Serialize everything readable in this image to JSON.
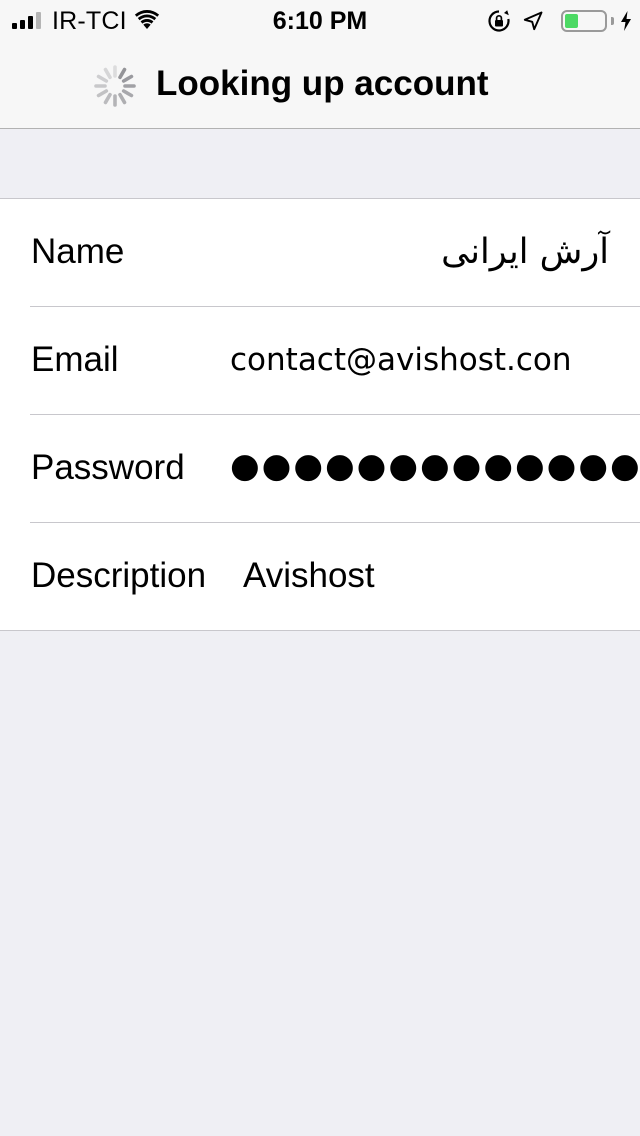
{
  "status_bar": {
    "carrier": "IR-TCI",
    "time": "6:10 PM",
    "battery_level": 0.35,
    "icons": [
      "signal-icon",
      "wifi-icon",
      "rotation-lock-icon",
      "location-icon",
      "battery-icon",
      "charging-icon"
    ]
  },
  "nav": {
    "title": "Looking up account",
    "activity_icon": "spinner-icon"
  },
  "form": {
    "name": {
      "label": "Name",
      "value": "آرش ایرانی"
    },
    "email": {
      "label": "Email",
      "value": "contact@avishost.con"
    },
    "password": {
      "label": "Password",
      "value": "●●●●●●●●●●●●●"
    },
    "description": {
      "label": "Description",
      "value": "Avishost"
    }
  },
  "colors": {
    "background": "#efeff4",
    "bar": "#f7f7f7",
    "separator": "#c8c7cc",
    "battery_fill": "#4cd964"
  }
}
